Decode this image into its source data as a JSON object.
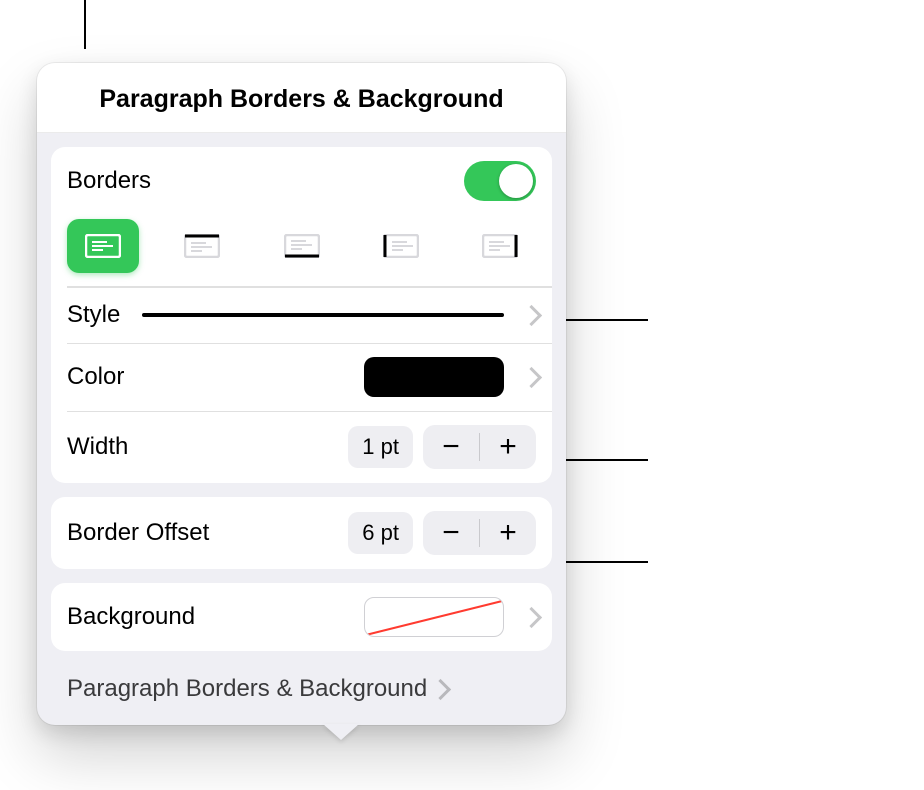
{
  "panel": {
    "title": "Paragraph Borders & Background"
  },
  "borders": {
    "label": "Borders",
    "enabled": true,
    "positions": {
      "outline": "border-outline",
      "top": "border-top",
      "bottom": "border-bottom",
      "left": "border-left",
      "right": "border-right"
    },
    "selected_position": "outline"
  },
  "style": {
    "label": "Style",
    "line_type": "solid"
  },
  "color": {
    "label": "Color",
    "value": "#000000"
  },
  "width": {
    "label": "Width",
    "value": "1 pt",
    "decrement_glyph": "−",
    "increment_glyph": "+"
  },
  "offset": {
    "label": "Border Offset",
    "value": "6 pt",
    "decrement_glyph": "−",
    "increment_glyph": "+"
  },
  "background": {
    "label": "Background",
    "value": "none"
  },
  "footer": {
    "label": "Paragraph Borders & Background"
  }
}
